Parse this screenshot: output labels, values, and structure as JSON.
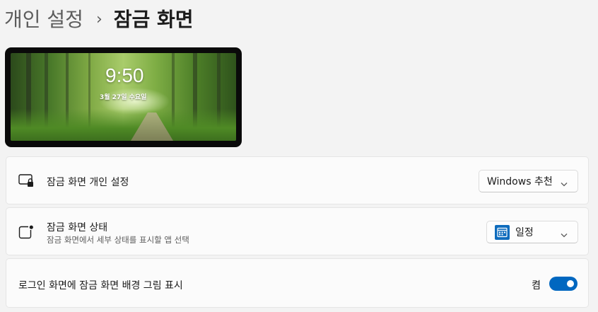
{
  "breadcrumb": {
    "parent": "개인 설정",
    "separator": "›",
    "current": "잠금 화면"
  },
  "preview": {
    "time": "9:50",
    "date": "3월 27일 수요일"
  },
  "settings": {
    "personalize": {
      "label": "잠금 화면 개인 설정",
      "value": "Windows 추천",
      "icon": "lock-screen-icon"
    },
    "status": {
      "label": "잠금 화면 상태",
      "description": "잠금 화면에서 세부 상태를 표시할 앱 선택",
      "value": "일정",
      "icon": "status-app-icon",
      "value_icon": "calendar-icon"
    },
    "signin_background": {
      "label": "로그인 화면에 잠금 화면 배경 그림 표시",
      "toggle_label": "켬",
      "toggle_on": true
    }
  },
  "colors": {
    "accent": "#0067c0",
    "calendar": "#0f6cbd",
    "background": "#f3f3f3",
    "card": "#fbfbfb"
  }
}
